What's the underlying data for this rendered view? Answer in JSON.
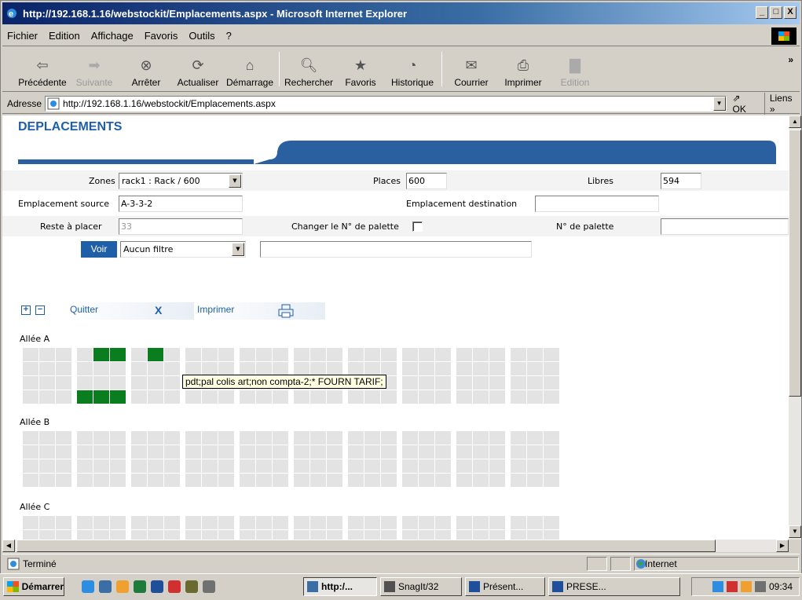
{
  "window": {
    "title": "http://192.168.1.16/webstockit/Emplacements.aspx - Microsoft Internet Explorer",
    "controls": [
      "_",
      "□",
      "X"
    ]
  },
  "menu": [
    "Fichier",
    "Edition",
    "Affichage",
    "Favoris",
    "Outils",
    "?"
  ],
  "toolbar": {
    "back": "Précédente",
    "forward": "Suivante",
    "stop": "Arrêter",
    "refresh": "Actualiser",
    "home": "Démarrage",
    "search": "Rechercher",
    "favorites": "Favoris",
    "history": "Historique",
    "mail": "Courrier",
    "print": "Imprimer",
    "edit": "Edition",
    "more": "»"
  },
  "address": {
    "label": "Adresse",
    "url": "http://192.168.1.16/webstockit/Emplacements.aspx",
    "go": "OK",
    "links": "Liens »"
  },
  "page": {
    "title": "DEPLACEMENTS",
    "zones_label": "Zones",
    "zones_value": "rack1 : Rack / 600",
    "places_label": "Places",
    "places_value": "600",
    "libres_label": "Libres",
    "libres_value": "594",
    "source_label": "Emplacement source",
    "source_value": "A-3-3-2",
    "dest_label": "Emplacement destination",
    "dest_value": "",
    "reste_label": "Reste à placer",
    "reste_value": "33",
    "change_pal_label": "Changer le N° de palette",
    "pal_label": "N° de palette",
    "pal_value": "",
    "voir": "Voir",
    "filter_value": "Aucun filtre",
    "filter_text": "",
    "quitter": "Quitter",
    "quitter_icon": "X",
    "imprimer": "Imprimer",
    "expand_icon": "+",
    "collapse_icon": "−",
    "aisles": [
      {
        "label": "Allée A",
        "occupied": [
          [
            0,
            4
          ],
          [
            0,
            5
          ],
          [
            0,
            7
          ],
          [
            3,
            3
          ],
          [
            3,
            4
          ],
          [
            3,
            5
          ]
        ]
      },
      {
        "label": "Allée B",
        "occupied": []
      },
      {
        "label": "Allée C",
        "occupied": []
      }
    ],
    "tooltip": "pdt;pal colis art;non compta-2;* FOURN TARIF;"
  },
  "status": {
    "text": "Terminé",
    "zone": "Internet"
  },
  "taskbar": {
    "start": "Démarrer",
    "tasks": [
      "http:/...",
      "SnagIt/32",
      "Présent...",
      "PRESE..."
    ],
    "clock": "09:34"
  },
  "colors": {
    "accent": "#1f5fa8",
    "occupied": "#0a7d1e",
    "empty_cell": "#e3e3e3"
  }
}
